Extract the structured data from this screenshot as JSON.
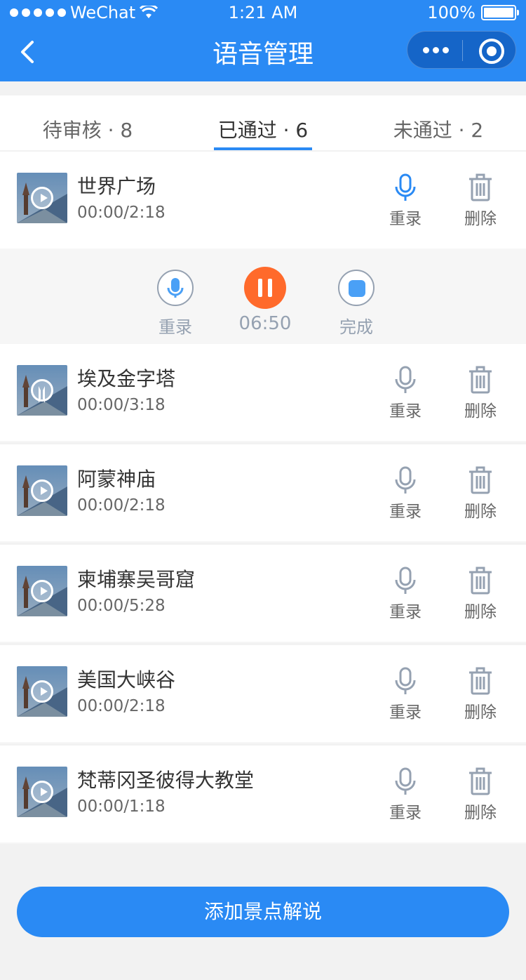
{
  "status_bar": {
    "carrier": "WeChat",
    "time": "1:21 AM",
    "battery": "100%"
  },
  "nav": {
    "title": "语音管理"
  },
  "tabs": [
    {
      "label": "待审核 · 8"
    },
    {
      "label": "已通过 · 6"
    },
    {
      "label": "未通过 · 2"
    }
  ],
  "recorder": {
    "rerecord_label": "重录",
    "time": "06:50",
    "done_label": "完成"
  },
  "actions": {
    "rerecord": "重录",
    "delete": "删除"
  },
  "items": [
    {
      "title": "世界广场",
      "duration": "00:00/2:18"
    },
    {
      "title": "埃及金字塔",
      "duration": "00:00/3:18"
    },
    {
      "title": "阿蒙神庙",
      "duration": "00:00/2:18"
    },
    {
      "title": "柬埔寨吴哥窟",
      "duration": "00:00/5:28"
    },
    {
      "title": "美国大峡谷",
      "duration": "00:00/2:18"
    },
    {
      "title": "梵蒂冈圣彼得大教堂",
      "duration": "00:00/1:18"
    }
  ],
  "add_button": "添加景点解说",
  "colors": {
    "primary": "#2a8af4",
    "pause": "#ff6a2b",
    "muted": "#95a1b1",
    "panel_bg": "#f6f6f6",
    "title": "#343434",
    "sub": "#666666"
  }
}
